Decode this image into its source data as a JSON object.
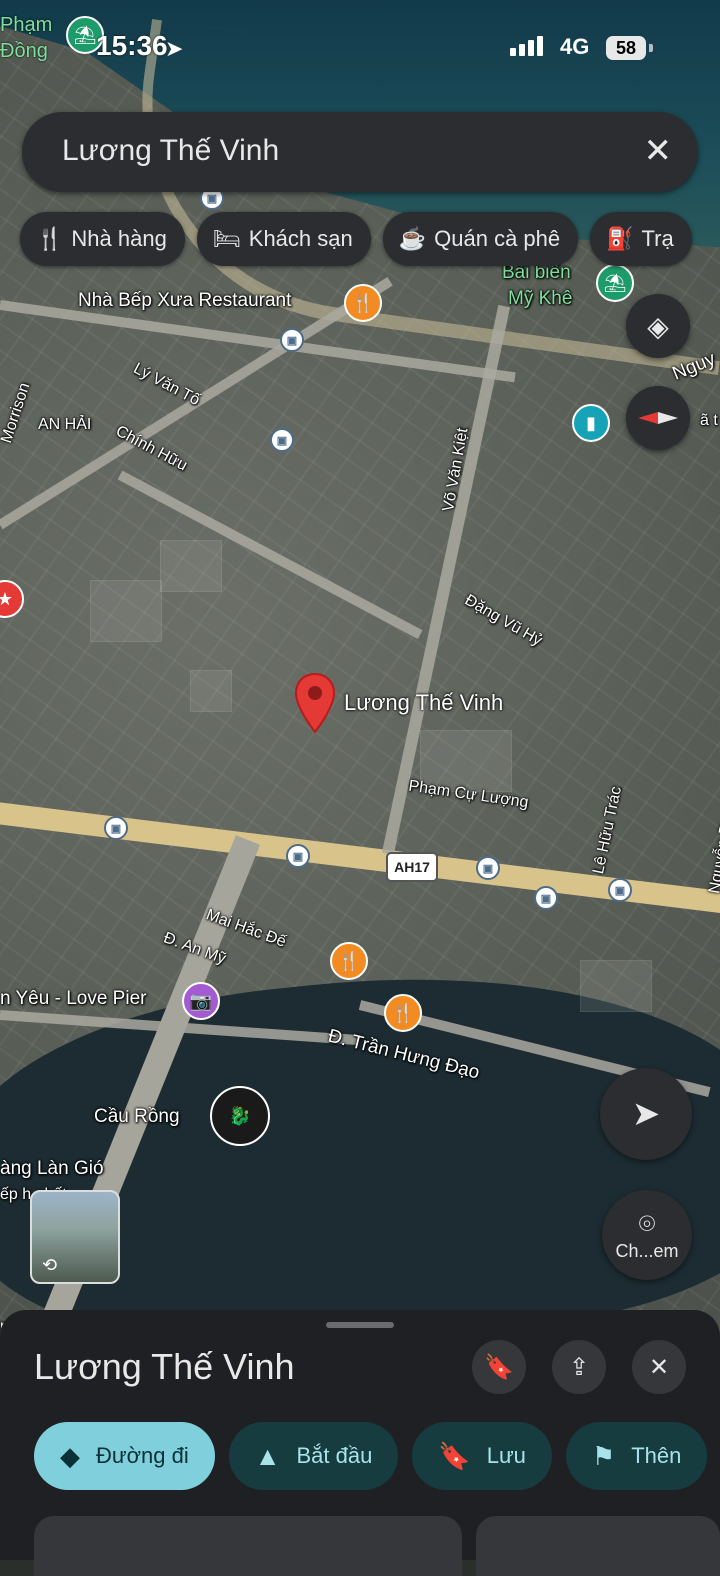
{
  "status_bar": {
    "poi_label_line1": "Phạm",
    "poi_label_line2": "Đồng",
    "time": "15:36",
    "network": "4G",
    "battery": "58"
  },
  "search": {
    "query": "Lương Thế Vinh",
    "clear_icon": "close-icon"
  },
  "chips": [
    {
      "icon": "restaurant-icon",
      "label": "Nhà hàng"
    },
    {
      "icon": "hotel-icon",
      "label": "Khách sạn"
    },
    {
      "icon": "coffee-icon",
      "label": "Quán cà phê"
    },
    {
      "icon": "gas-station-icon",
      "label": "Trạ"
    }
  ],
  "map": {
    "labels": {
      "restaurant": "Nhà Bếp Xưa Restaurant",
      "beach_line1": "Bãi biển",
      "beach_line2": "Mỹ Khê",
      "nguy": "Nguy",
      "morrison": "Morrison",
      "an_hai": "AN HẢI",
      "ly_van_to": "Lý Văn Tố",
      "chinh_huu": "Chính Hữu",
      "vo_van_kiet": "Võ Văn Kiệt",
      "dang_vu_hy": "Đặng Vũ Hỷ",
      "pin_label": "Lương Thế Vinh",
      "pham_cu_luong": "Phạm Cự Lượng",
      "le_huu_trac": "Lê Hữu Trác",
      "nguyen_duy": "Nguyễn Duy Hiệu",
      "highway": "AH17",
      "mai_hac_de": "Mai Hắc Đế",
      "an_my": "Đ. An Mỹ",
      "love_pier": "n Yêu - Love Pier",
      "tran_hung_dao": "Đ. Trần Hưng Đạo",
      "cau_rong": "Cầu Rồng",
      "lang_gio": "àng Làn Gió",
      "ep_nhat": "ếp h         nhất",
      "da_ta": "ã t",
      "corner_fragment": "n"
    }
  },
  "fabs": {
    "layers": "layers-icon",
    "compass": "compass-icon",
    "location": "navigation-arrow-icon",
    "lens_label": "Ch...em"
  },
  "sheet": {
    "title": "Lương Thế Vinh",
    "actions": [
      {
        "icon": "directions-icon",
        "label": "Đường đi"
      },
      {
        "icon": "start-navigation-icon",
        "label": "Bắt đầu"
      },
      {
        "icon": "bookmark-icon",
        "label": "Lưu"
      },
      {
        "icon": "flag-icon",
        "label": "Thên"
      }
    ]
  }
}
